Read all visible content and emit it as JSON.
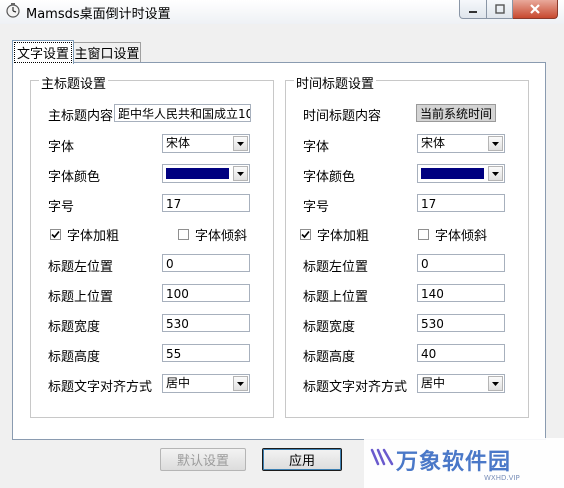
{
  "window": {
    "title": "Mamsds桌面倒计时设置"
  },
  "tabs": [
    {
      "label": "文字设置",
      "active": true
    },
    {
      "label": "主窗口设置",
      "active": false
    }
  ],
  "main_group": {
    "title": "主标题设置",
    "content_label": "主标题内容",
    "content_value": "距中华人民共和国成立10",
    "font_label": "字体",
    "font_value": "宋体",
    "color_label": "字体颜色",
    "color_value": "#000080",
    "size_label": "字号",
    "size_value": "17",
    "bold_label": "字体加粗",
    "bold_checked": true,
    "italic_label": "字体倾斜",
    "italic_checked": false,
    "left_label": "标题左位置",
    "left_value": "0",
    "top_label": "标题上位置",
    "top_value": "100",
    "width_label": "标题宽度",
    "width_value": "530",
    "height_label": "标题高度",
    "height_value": "55",
    "align_label": "标题文字对齐方式",
    "align_value": "居中"
  },
  "time_group": {
    "title": "时间标题设置",
    "content_label": "时间标题内容",
    "content_value": "当前系统时间",
    "font_label": "字体",
    "font_value": "宋体",
    "color_label": "字体颜色",
    "color_value": "#000080",
    "size_label": "字号",
    "size_value": "17",
    "bold_label": "字体加粗",
    "bold_checked": true,
    "italic_label": "字体倾斜",
    "italic_checked": false,
    "left_label": "标题左位置",
    "left_value": "0",
    "top_label": "标题上位置",
    "top_value": "140",
    "width_label": "标题宽度",
    "width_value": "530",
    "height_label": "标题高度",
    "height_value": "40",
    "align_label": "标题文字对齐方式",
    "align_value": "居中"
  },
  "buttons": {
    "default_label": "默认设置",
    "apply_label": "应用"
  },
  "watermark": {
    "text": "万象软件园",
    "sub": "WXHD.VIP"
  }
}
